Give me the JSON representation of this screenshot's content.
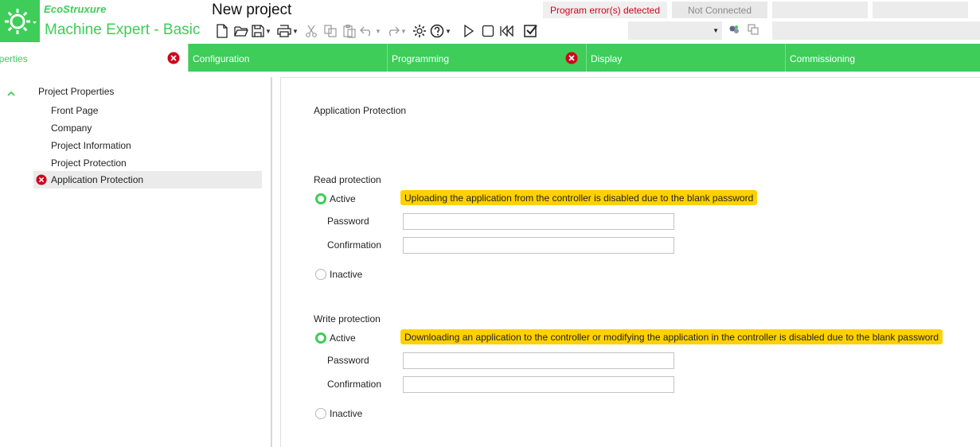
{
  "header": {
    "brand": "EcoStruxure",
    "app_title": "Machine Expert - Basic",
    "project_name": "New project",
    "status_error": "Program error(s) detected",
    "status_connection": "Not Connected"
  },
  "toolbar": {
    "icons": [
      "new-file-icon",
      "open-folder-icon",
      "save-icon",
      "print-icon",
      "cut-icon",
      "copy-icon",
      "paste-icon",
      "undo-icon",
      "redo-icon",
      "settings-icon",
      "help-icon",
      "run-icon",
      "stop-icon",
      "rewind-icon",
      "check-icon"
    ]
  },
  "tabs": [
    {
      "label": "Properties",
      "has_error": true,
      "active": true
    },
    {
      "label": "Configuration",
      "has_error": false
    },
    {
      "label": "Programming",
      "has_error": true
    },
    {
      "label": "Display",
      "has_error": false
    },
    {
      "label": "Commissioning",
      "has_error": false
    }
  ],
  "tree": {
    "root": "Project Properties",
    "items": [
      "Front Page",
      "Company",
      "Project Information",
      "Project Protection",
      "Application Protection"
    ],
    "selected": "Application Protection"
  },
  "main": {
    "title": "Application Protection",
    "read": {
      "title": "Read protection",
      "active_label": "Active",
      "warning": "Uploading the application from the controller is disabled due to the blank password",
      "password_label": "Password",
      "confirmation_label": "Confirmation",
      "inactive_label": "Inactive",
      "password_value": "",
      "confirmation_value": ""
    },
    "write": {
      "title": "Write protection",
      "active_label": "Active",
      "warning": "Downloading an application to the controller or modifying the application in the controller is disabled due to the blank password",
      "password_label": "Password",
      "confirmation_label": "Confirmation",
      "inactive_label": "Inactive",
      "password_value": "",
      "confirmation_value": ""
    }
  },
  "colors": {
    "accent": "#3dcd58",
    "error": "#d0021b",
    "warning": "#ffd100"
  }
}
